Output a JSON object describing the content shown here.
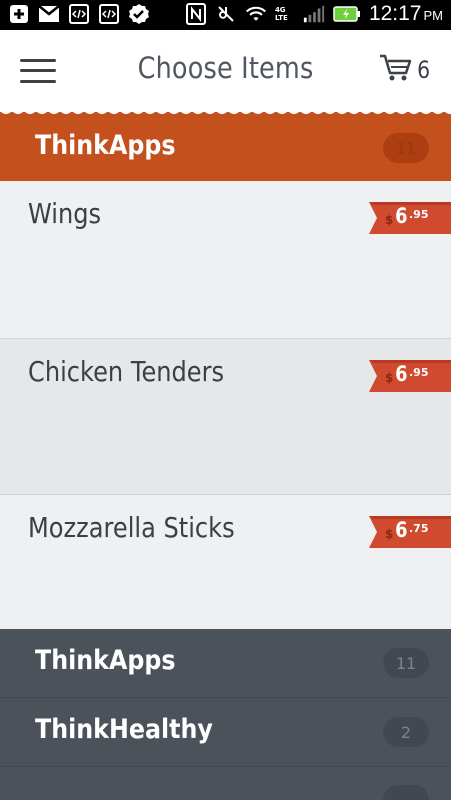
{
  "status_bar": {
    "time": "12:17",
    "ampm": "PM",
    "network": "4G LTE",
    "icons": [
      "add-box-icon",
      "gmail-icon",
      "code-icon",
      "code-icon",
      "check-icon",
      "nfc-icon",
      "mute-icon",
      "wifi-icon",
      "signal-icon",
      "battery-icon"
    ]
  },
  "header": {
    "title": "Choose Items",
    "cart_count": "6",
    "menu_icon": "hamburger-menu-icon",
    "cart_icon": "cart-icon"
  },
  "active_section": {
    "name": "ThinkApps",
    "count": "11"
  },
  "items": [
    {
      "name": "Wings",
      "currency": "$",
      "dollars": "6",
      "cents": ".95"
    },
    {
      "name": "Chicken Tenders",
      "currency": "$",
      "dollars": "6",
      "cents": ".95"
    },
    {
      "name": "Mozzarella Sticks",
      "currency": "$",
      "dollars": "6",
      "cents": ".75"
    }
  ],
  "sections": [
    {
      "name": "ThinkApps",
      "count": "11"
    },
    {
      "name": "ThinkHealthy",
      "count": "2"
    }
  ],
  "colors": {
    "accent": "#c4501e",
    "price_tag": "#d04a30",
    "dark_section": "#4b525a",
    "item_bg_light": "#eff0f2",
    "item_bg_alt": "#e6e7e9"
  }
}
